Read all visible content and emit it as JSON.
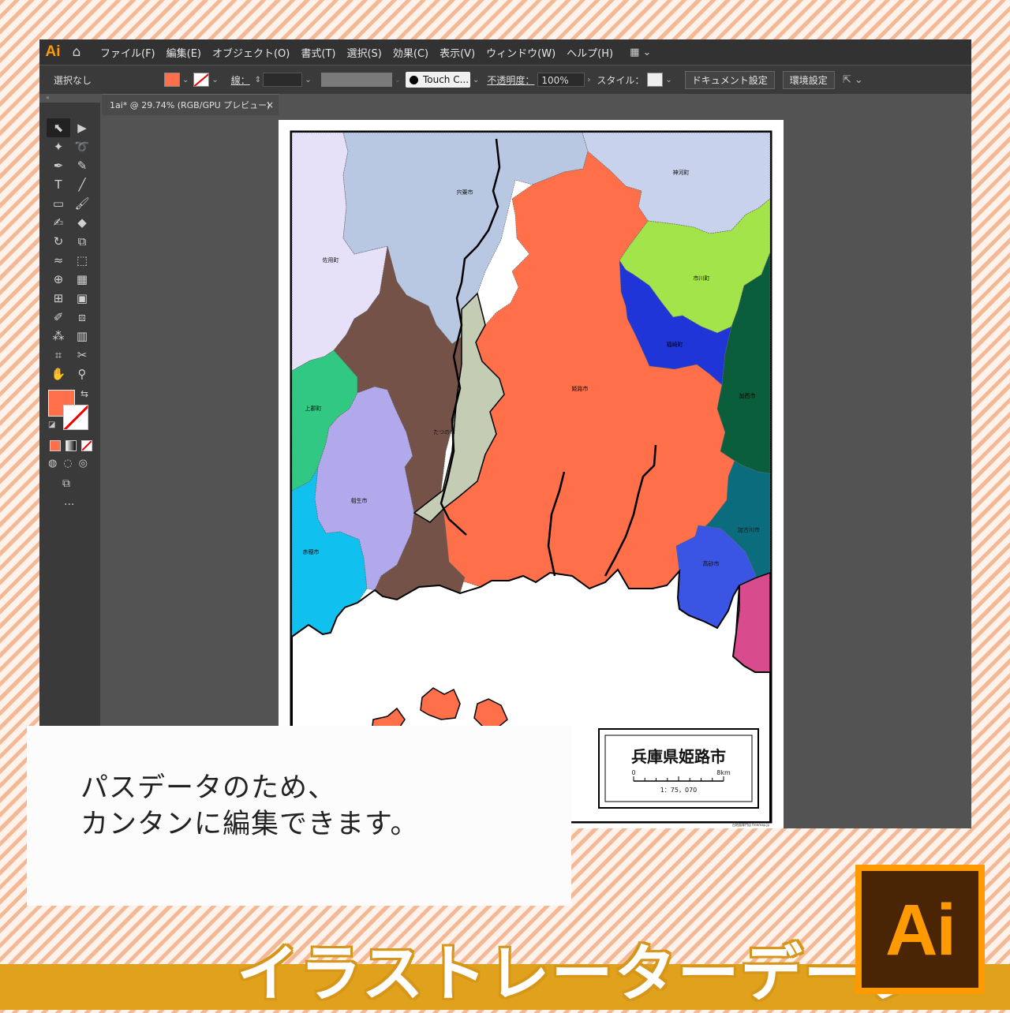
{
  "menubar": {
    "app_logo": "Ai",
    "items": [
      "ファイル(F)",
      "編集(E)",
      "オブジェクト(O)",
      "書式(T)",
      "選択(S)",
      "効果(C)",
      "表示(V)",
      "ウィンドウ(W)",
      "ヘルプ(H)"
    ]
  },
  "controlbar": {
    "selection": "選択なし",
    "stroke_label": "線：",
    "brush": "Touch C...",
    "opacity_label": "不透明度：",
    "opacity_value": "100%",
    "style_label": "スタイル：",
    "document_settings": "ドキュメント設定",
    "preferences": "環境設定"
  },
  "colors": {
    "fill": "#ff704a",
    "accent": "#ff9a00",
    "band": "#e0a21c"
  },
  "document_tab": {
    "title": "1ai* @ 29.74% (RGB/GPU プレビュー)",
    "close": "×"
  },
  "map": {
    "regions": [
      {
        "label": "宍粟市",
        "color": "#b8c8e2"
      },
      {
        "label": "神河町",
        "color": "#c8d2ec"
      },
      {
        "label": "佐用町",
        "color": "#e6e0f8"
      },
      {
        "label": "市川町",
        "color": "#a2e44a"
      },
      {
        "label": "福崎町",
        "color": "#1f35d8"
      },
      {
        "label": "姫路市",
        "color": "#ff704a"
      },
      {
        "label": "加西市",
        "color": "#0a5e3c"
      },
      {
        "label": "上郡町",
        "color": "#30c882"
      },
      {
        "label": "たつの市",
        "color": "#745248"
      },
      {
        "label": "相生市",
        "color": "#b2a8ec"
      },
      {
        "label": "加古川市",
        "color": "#0a6c7c"
      },
      {
        "label": "高砂市",
        "color": "#3a54e4"
      },
      {
        "label": "赤穂市",
        "color": "#10c0ee"
      }
    ],
    "title": "兵庫県姫路市",
    "scale_start": "0",
    "scale_end": "8km",
    "scale_ratio": "1：75，070",
    "credit": "白地図専門店 freemap.jp"
  },
  "caption": {
    "line1": "パスデータのため、",
    "line2": "カンタンに編集できます。"
  },
  "banner": {
    "text": "イラストレーターデータ",
    "badge": "Ai"
  }
}
